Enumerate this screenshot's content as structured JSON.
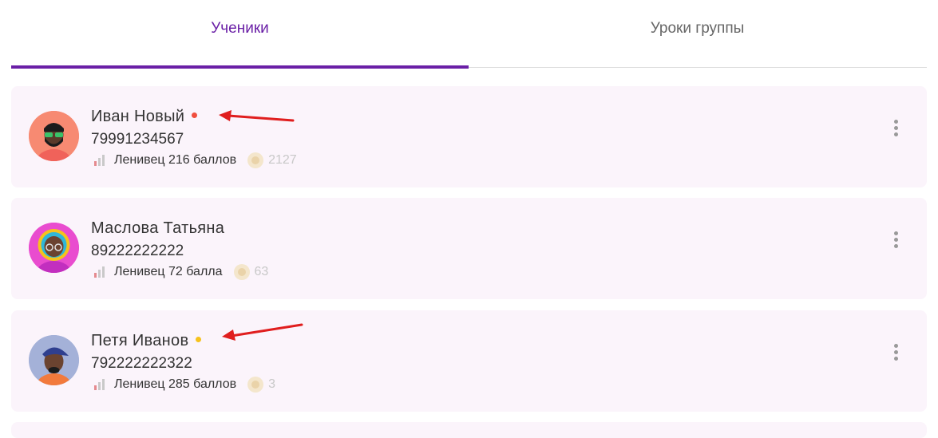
{
  "tabs": [
    {
      "label": "Ученики",
      "active": true
    },
    {
      "label": "Уроки группы",
      "active": false
    }
  ],
  "students": [
    {
      "name": "Иван Новый",
      "status_color": "#f04e3e",
      "phone": "79991234567",
      "level": "Ленивец 216 баллов",
      "coins": "2127",
      "avatar_bg": "#f78a72"
    },
    {
      "name": "Маслова Татьяна",
      "status_color": "",
      "phone": "89222222222",
      "level": "Ленивец 72 балла",
      "coins": "63",
      "avatar_bg": "#e94ccf"
    },
    {
      "name": "Петя Иванов",
      "status_color": "#f6c21c",
      "phone": "792222222322",
      "level": "Ленивец 285 баллов",
      "coins": "3",
      "avatar_bg": "#a4b1d8"
    }
  ],
  "colors": {
    "accent": "#6a1fa6",
    "card_bg": "#fbf4fb",
    "annotation_arrow": "#e01e1e"
  }
}
